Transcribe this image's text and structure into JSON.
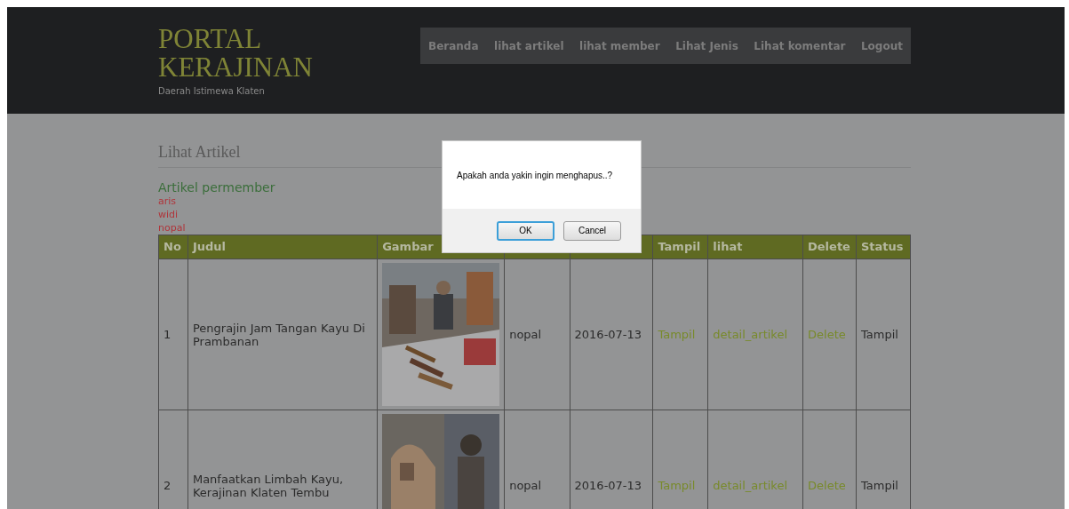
{
  "header": {
    "title": "PORTAL KERAJINAN",
    "subtitle": "Daerah Istimewa Klaten"
  },
  "nav": [
    {
      "label": "Beranda"
    },
    {
      "label": "lihat artikel"
    },
    {
      "label": "lihat member"
    },
    {
      "label": "Lihat Jenis"
    },
    {
      "label": "Lihat komentar"
    },
    {
      "label": "Logout"
    }
  ],
  "page_heading": "Lihat Artikel",
  "members_section": {
    "title": "Artikel permember",
    "members": [
      "aris",
      "widi",
      "nopal"
    ]
  },
  "table": {
    "columns": [
      {
        "label": "No"
      },
      {
        "label": "Judul"
      },
      {
        "label": "Gambar"
      },
      {},
      {},
      {
        "label": "Tampil"
      },
      {
        "label": "lihat"
      },
      {
        "label": "Delete"
      },
      {
        "label": "Status"
      }
    ],
    "rows": [
      {
        "no": "1",
        "judul": "Pengrajin Jam Tangan Kayu Di Prambanan",
        "member": "nopal",
        "date": "2016-07-13",
        "tampil": "Tampil",
        "lihat": "detail_artikel",
        "delete": "Delete",
        "status": "Tampil"
      },
      {
        "no": "2",
        "judul": "Manfaatkan Limbah Kayu, Kerajinan Klaten Tembu",
        "member": "nopal",
        "date": "2016-07-13",
        "tampil": "Tampil",
        "lihat": "detail_artikel",
        "delete": "Delete",
        "status": "Tampil"
      }
    ]
  },
  "dialog": {
    "message": "Apakah anda yakin ingin menghapus..?",
    "buttons": [
      {
        "label": "OK",
        "default": true
      },
      {
        "label": "Cancel",
        "default": false
      }
    ]
  }
}
